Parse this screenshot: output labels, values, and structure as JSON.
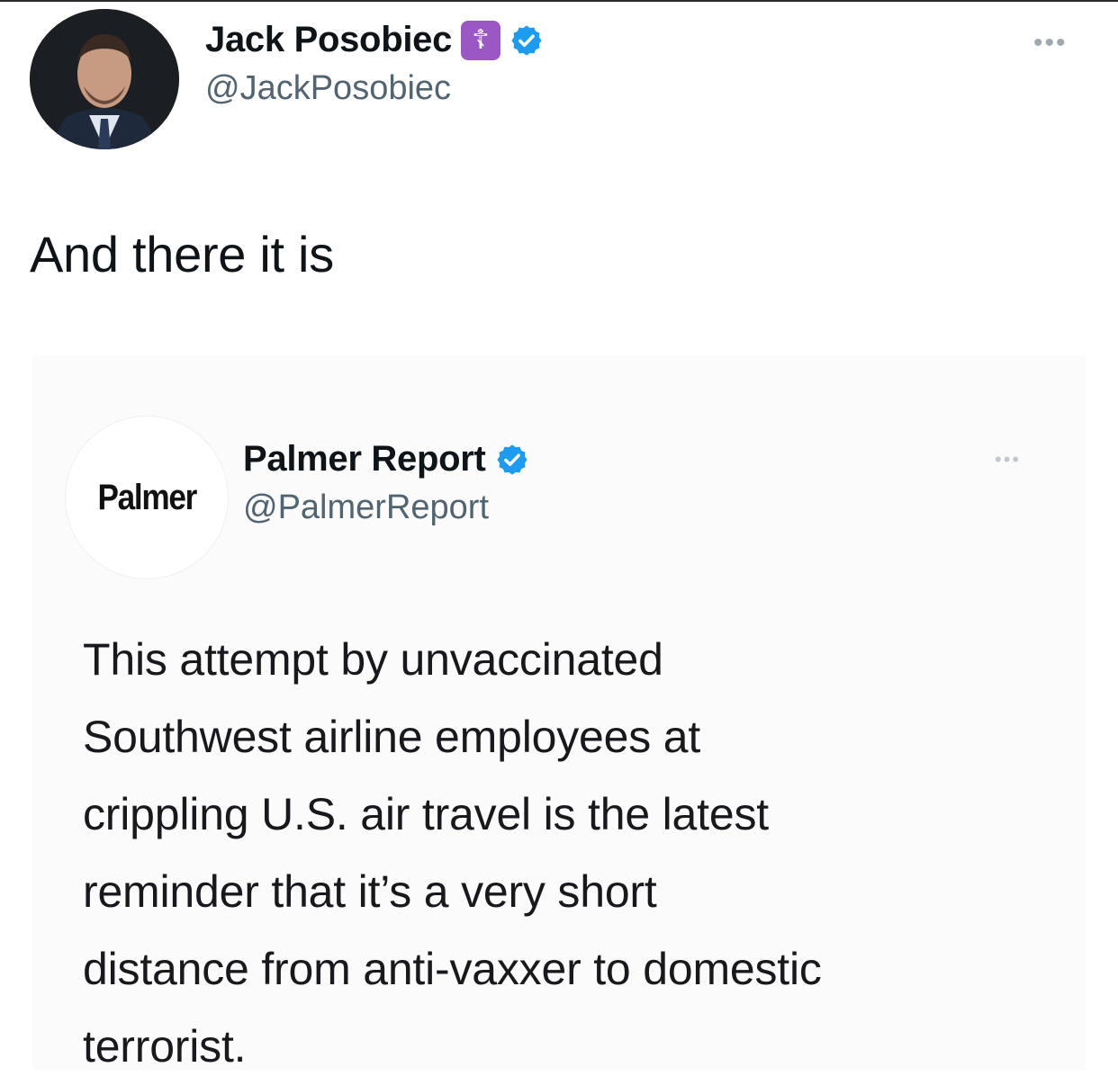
{
  "tweet": {
    "author": {
      "display_name": "Jack Posobiec",
      "badge_emoji": "☦",
      "handle": "@JackPosobiec",
      "verified_icon": "verified-badge-icon"
    },
    "more_icon": "more-options-icon",
    "text": "And there it is"
  },
  "quoted_tweet": {
    "avatar_logo_text": "Palmer",
    "author": {
      "display_name": "Palmer Report",
      "handle": "@PalmerReport",
      "verified_icon": "verified-badge-icon"
    },
    "more_icon": "more-options-icon",
    "text_lines": [
      "This attempt by unvaccinated",
      "Southwest airline employees at",
      "crippling U.S. air travel is the latest",
      "reminder that it’s a very short",
      "distance from anti-vaxxer to domestic",
      "terrorist."
    ]
  },
  "colors": {
    "verified_blue": "#1d9bf0",
    "badge_purple": "#9b57c4",
    "secondary_text": "#536471"
  }
}
